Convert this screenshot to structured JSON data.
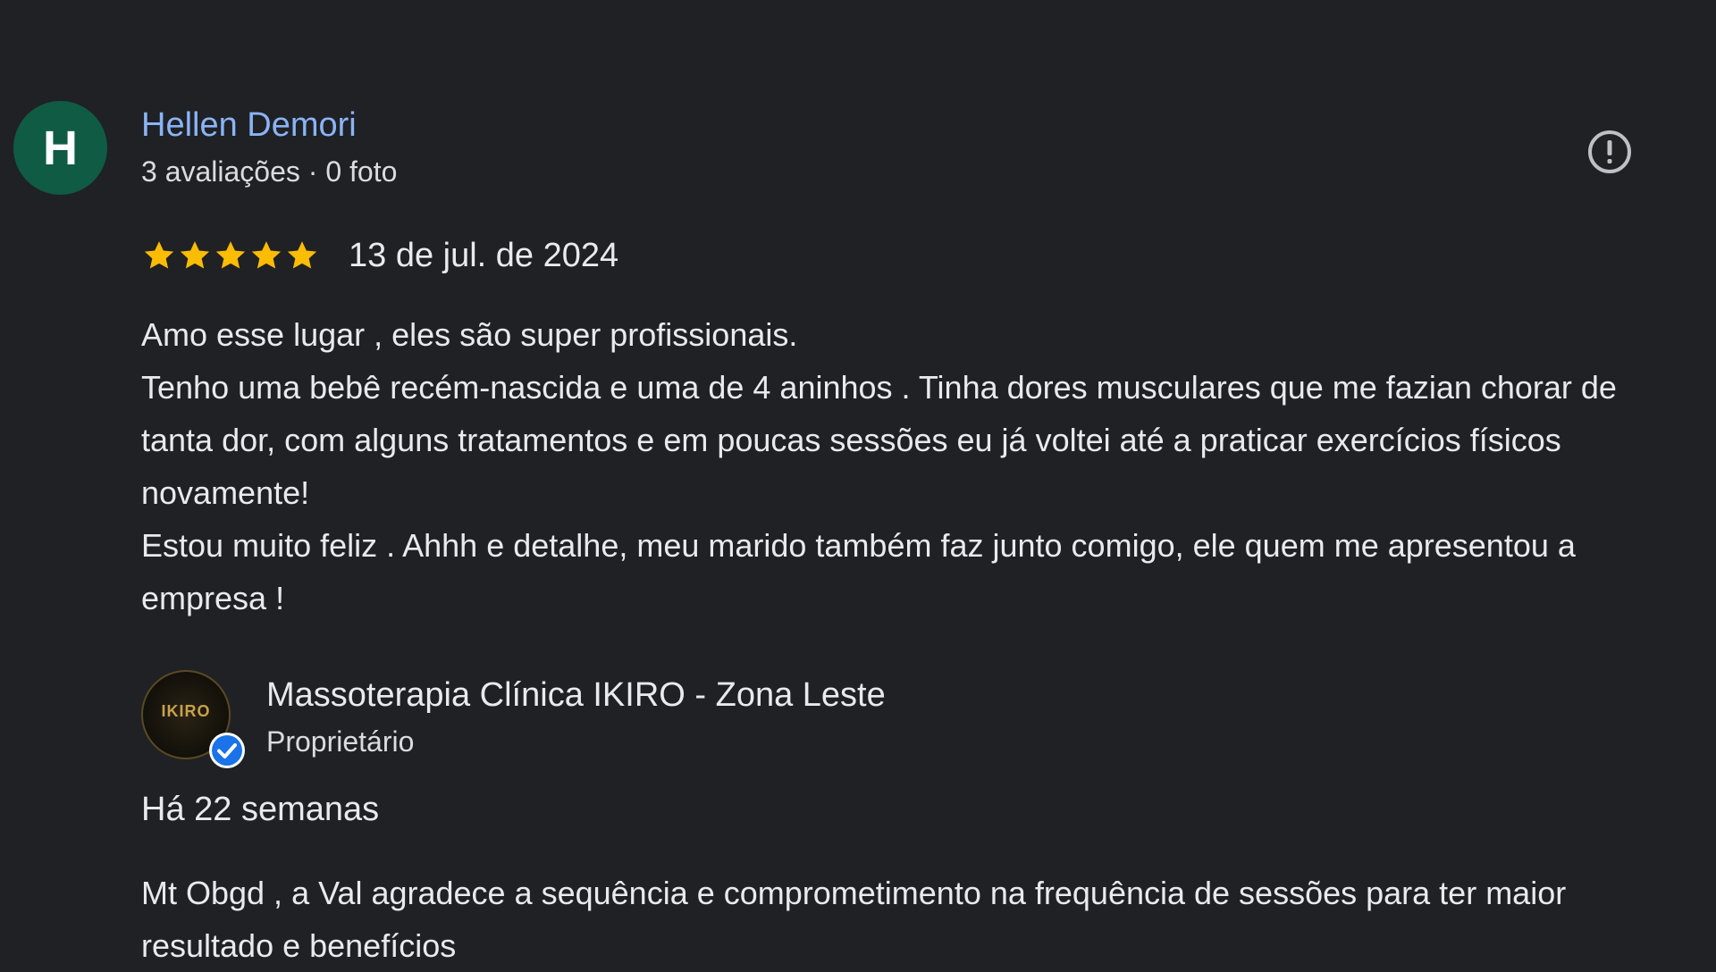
{
  "review": {
    "avatar_letter": "H",
    "avatar_color": "#0f5b43",
    "author_name": "Hellen Demori",
    "author_meta": "3 avaliações · 0 foto",
    "report_icon": "report-icon",
    "rating": 5,
    "rating_max": 5,
    "date": "13 de jul. de 2024",
    "text_lines": [
      "Amo esse lugar , eles são super profissionais.",
      "Tenho uma bebê recém-nascida e uma de 4 aninhos . Tinha dores musculares que me fazian chorar de tanta dor, com alguns tratamentos e em poucas sessões eu já voltei até a praticar exercícios físicos novamente!",
      "Estou muito feliz . Ahhh e detalhe, meu marido também faz junto comigo, ele quem me apresentou a empresa !"
    ]
  },
  "owner_response": {
    "logo_text": "IKIRO",
    "verified_icon": "verified-check-icon",
    "business_name": "Massoterapia Clínica IKIRO - Zona Leste",
    "role": "Proprietário",
    "time": "Há 22 semanas",
    "text": "Mt Obgd , a Val agradece a sequência e comprometimento na frequência de sessões para ter maior resultado e benefícios"
  },
  "colors": {
    "background": "#202124",
    "link": "#8ab4f8",
    "star": "#fbbc04",
    "verified": "#1a73e8"
  }
}
